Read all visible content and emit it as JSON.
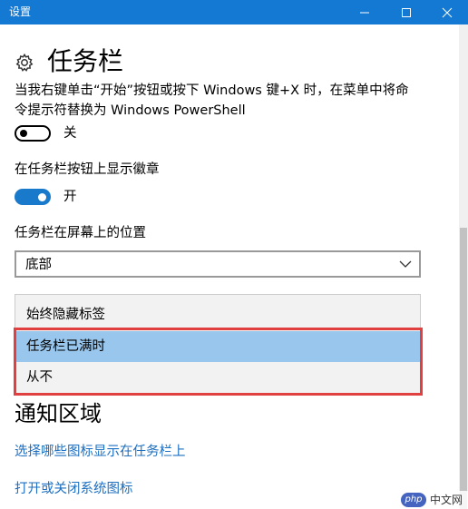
{
  "window": {
    "title": "设置",
    "accent": "#1479d3"
  },
  "page": {
    "title": "任务栏",
    "icon": "gear-icon"
  },
  "settings": {
    "powershell_desc_line1": "当我右键单击“开始”按钮或按下 Windows 键+X 时，在菜单中将命",
    "powershell_desc_line2": "令提示符替换为 Windows PowerShell",
    "powershell_toggle": {
      "state": "off",
      "label": "关"
    },
    "badges_label": "在任务栏按钮上显示徽章",
    "badges_toggle": {
      "state": "on",
      "label": "开",
      "color": "#1979ca"
    },
    "position_label": "任务栏在屏幕上的位置",
    "position_value": "底部",
    "combine_options": [
      "始终隐藏标签",
      "任务栏已满时",
      "从不"
    ],
    "combine_selected_index": 1,
    "highlight_color": "#e04040"
  },
  "notification": {
    "title": "通知区域",
    "link_icons": "选择哪些图标显示在任务栏上",
    "link_system_icons": "打开或关闭系统图标"
  },
  "watermark": {
    "badge": "php",
    "text": "中文网"
  }
}
